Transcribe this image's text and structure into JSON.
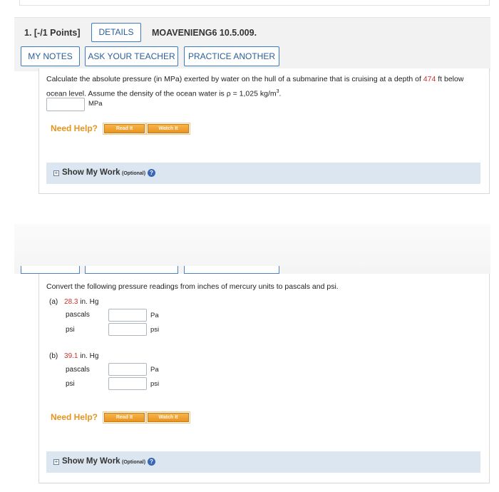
{
  "q1": {
    "title": "1. [-/1 Points]",
    "details_label": "DETAILS",
    "code": "MOAVENIENG6 10.5.009.",
    "my_notes_label": "MY NOTES",
    "ask_teacher_label": "ASK YOUR TEACHER",
    "practice_label": "PRACTICE ANOTHER",
    "prompt_part1": "Calculate the absolute pressure (in MPa) exerted by water on the hull of a submarine that is cruising at a depth of",
    "depth_value": "474",
    "prompt_part2": "ft below",
    "prompt_line2": "ocean level. Assume the density of the ocean water is ρ = 1,025 kg/m",
    "prompt_sup": "3",
    "prompt_end": ".",
    "answer_unit": "MPa",
    "answer_value": "",
    "need_help": "Need Help?",
    "read_it": "Read It",
    "watch_it": "Watch It",
    "show_work": "Show My Work",
    "optional": "(Optional)"
  },
  "q2": {
    "prompt": "Convert the following pressure readings from inches of mercury units to pascals and psi.",
    "part_a_label": "(a)",
    "part_a_value": "28.3",
    "part_a_unit": "in. Hg",
    "part_b_label": "(b)",
    "part_b_value": "39.1",
    "part_b_unit": "in. Hg",
    "pascals_label": "pascals",
    "psi_label": "psi",
    "pa_unit": "Pa",
    "psi_unit": "psi",
    "need_help": "Need Help?",
    "read_it": "Read It",
    "watch_it": "Watch It",
    "show_work": "Show My Work",
    "optional": "(Optional)"
  },
  "icons": {
    "expand": "plus-box-icon",
    "help": "help-circle-icon"
  },
  "colors": {
    "accent": "#3b7bbf",
    "highlight_value": "#d0302a",
    "need_help": "#e69420",
    "show_work_bg": "#dce6f1"
  }
}
